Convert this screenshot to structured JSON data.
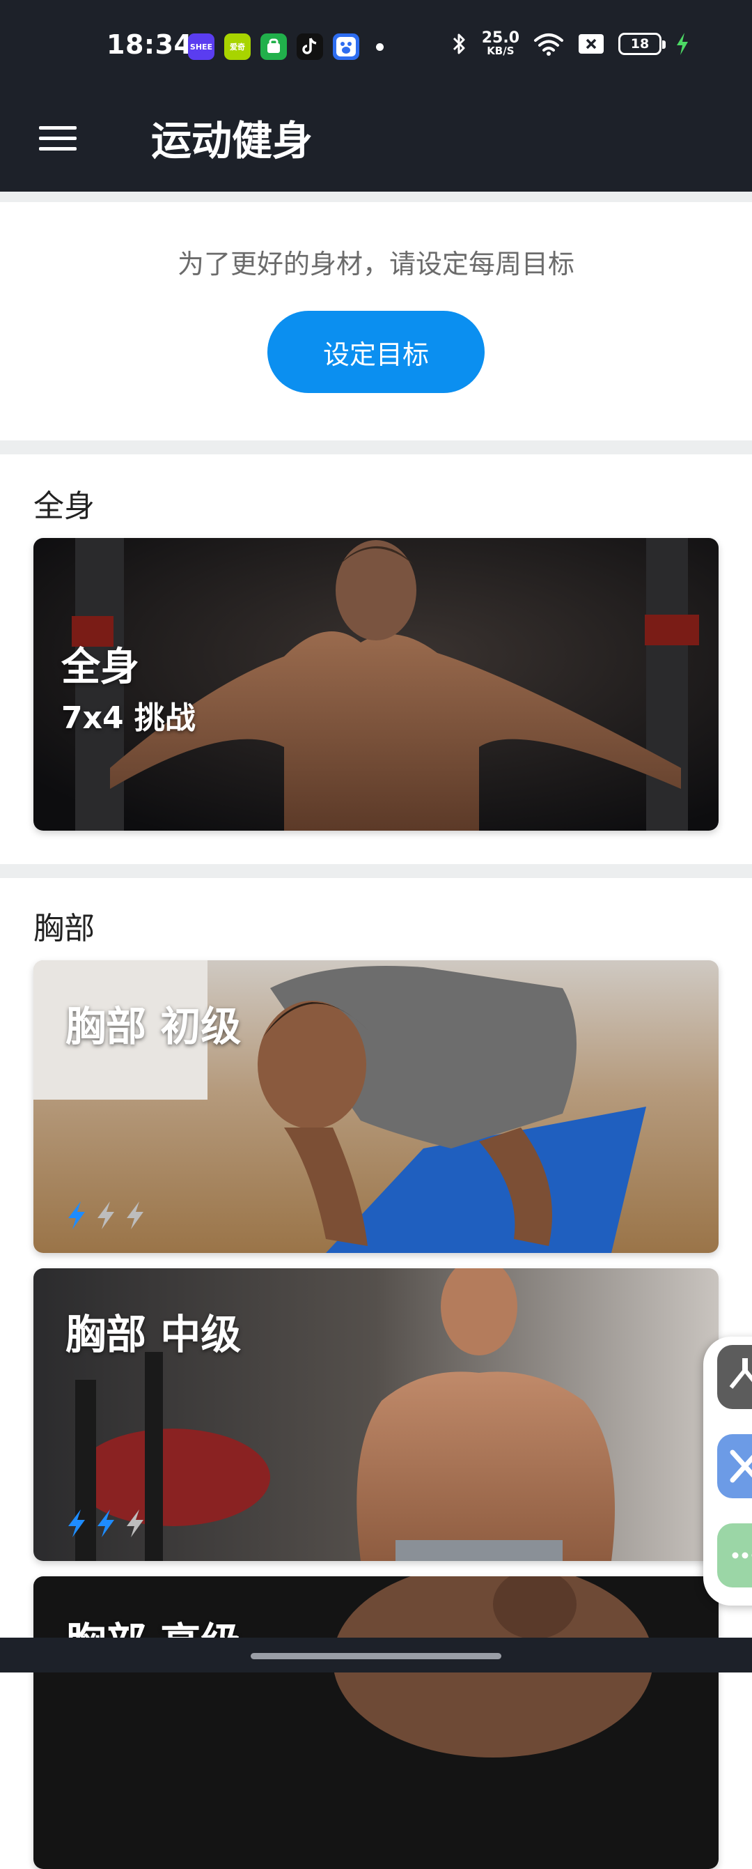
{
  "status_bar": {
    "time": "18:34",
    "net_speed_value": "25.0",
    "net_speed_unit": "KB/S",
    "battery": "18",
    "app_icons": [
      {
        "name": "shee-app-icon",
        "label": "SHEE",
        "color": "#5a3df0"
      },
      {
        "name": "iqiyi-app-icon",
        "label": "爱奇",
        "color": "#a8d400"
      },
      {
        "name": "green-app-icon",
        "label": "",
        "color": "#21b04b"
      },
      {
        "name": "tiktok-app-icon",
        "label": "",
        "color": "#111111"
      },
      {
        "name": "baidu-app-icon",
        "label": "",
        "color": "#2e6df0"
      }
    ]
  },
  "app_bar": {
    "title": "运动健身"
  },
  "goal": {
    "hint": "为了更好的身材，请设定每周目标",
    "button_label": "设定目标"
  },
  "sections": {
    "full_body": {
      "title": "全身",
      "card": {
        "title": "全身",
        "subtitle": "7x4 挑战"
      }
    },
    "chest": {
      "title": "胸部",
      "cards": [
        {
          "title": "胸部 初级",
          "difficulty": 1,
          "max": 3
        },
        {
          "title": "胸部 中级",
          "difficulty": 2,
          "max": 3
        },
        {
          "title": "胸部 高级"
        }
      ]
    }
  },
  "colors": {
    "accent": "#0b8ff0",
    "bolt_active": "#1e8cff",
    "bolt_inactive": "#bdbdbd",
    "app_bar": "#1d2129"
  }
}
